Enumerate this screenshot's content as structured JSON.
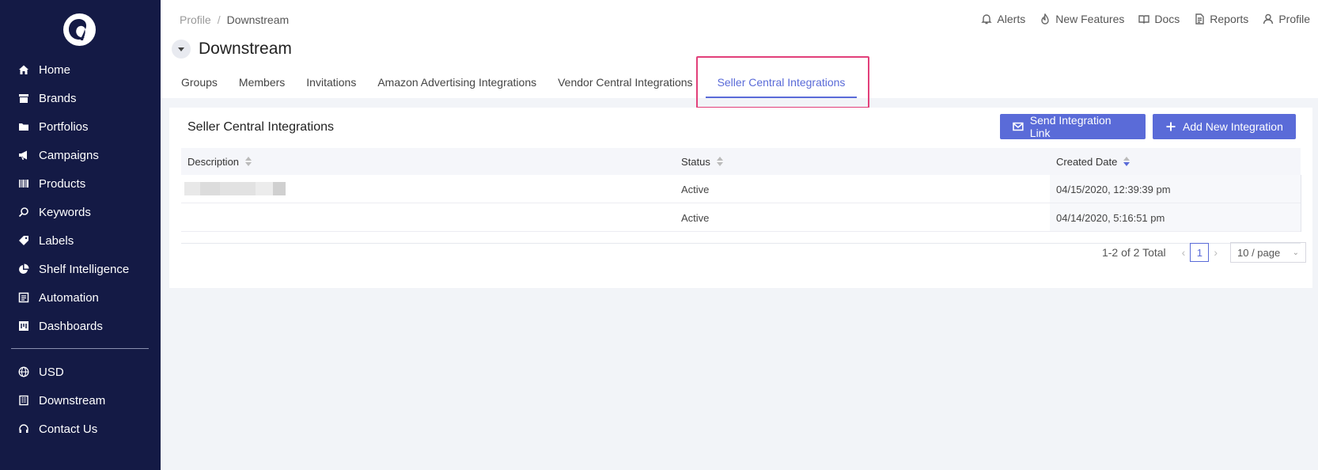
{
  "sidebar": {
    "items": [
      {
        "label": "Home",
        "icon": "home-icon"
      },
      {
        "label": "Brands",
        "icon": "store-icon"
      },
      {
        "label": "Portfolios",
        "icon": "folder-icon"
      },
      {
        "label": "Campaigns",
        "icon": "megaphone-icon"
      },
      {
        "label": "Products",
        "icon": "barcode-icon"
      },
      {
        "label": "Keywords",
        "icon": "search-icon"
      },
      {
        "label": "Labels",
        "icon": "tag-icon"
      },
      {
        "label": "Shelf Intelligence",
        "icon": "pie-chart-icon"
      },
      {
        "label": "Automation",
        "icon": "automation-icon"
      },
      {
        "label": "Dashboards",
        "icon": "dashboard-icon"
      }
    ],
    "bottom": [
      {
        "label": "USD",
        "icon": "globe-icon"
      },
      {
        "label": "Downstream",
        "icon": "building-icon"
      },
      {
        "label": "Contact Us",
        "icon": "headset-icon"
      }
    ]
  },
  "breadcrumb": {
    "parent": "Profile",
    "separator": "/",
    "current": "Downstream"
  },
  "toplinks": {
    "alerts": "Alerts",
    "new_features": "New Features",
    "docs": "Docs",
    "reports": "Reports",
    "profile": "Profile"
  },
  "page": {
    "title": "Downstream"
  },
  "tabs": [
    "Groups",
    "Members",
    "Invitations",
    "Amazon Advertising Integrations",
    "Vendor Central Integrations",
    "Seller Central Integrations"
  ],
  "active_tab": "Seller Central Integrations",
  "card": {
    "title": "Seller Central Integrations",
    "send_label": "Send Integration Link",
    "add_label": "Add New Integration"
  },
  "table": {
    "headers": {
      "description": "Description",
      "status": "Status",
      "created": "Created Date"
    },
    "rows": [
      {
        "description": "",
        "status": "Active",
        "created": "04/15/2020, 12:39:39 pm"
      },
      {
        "description": "",
        "status": "Active",
        "created": "04/14/2020, 5:16:51 pm"
      }
    ]
  },
  "pager": {
    "total": "1-2 of 2 Total",
    "page": "1",
    "size": "10 / page"
  },
  "colors": {
    "sidebar": "#141a45",
    "accent": "#5a6bd8",
    "highlight": "#e2407a"
  }
}
